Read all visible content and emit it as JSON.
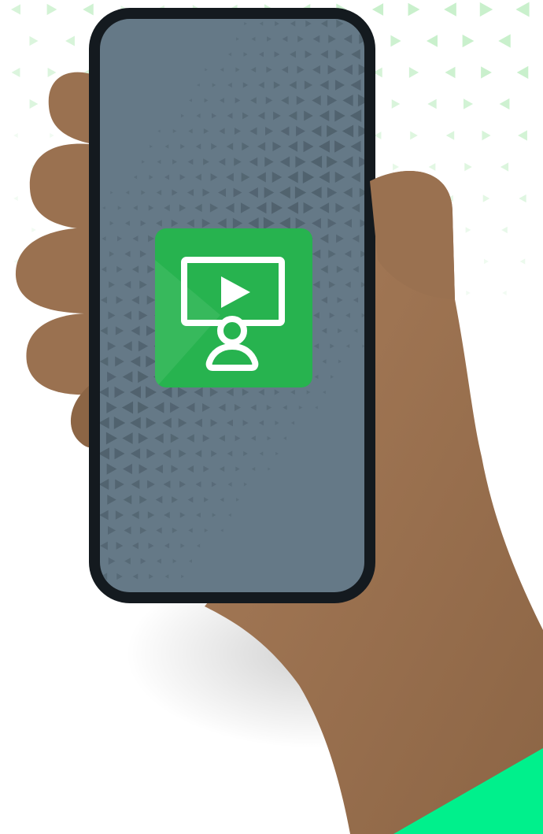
{
  "scene": {
    "background_color": "#ffffff",
    "pattern_color": "#c9f0cc",
    "hand_color": "#9a7150",
    "hand_shadow_color": "#7d5a3f",
    "sleeve_color": "#00f08c",
    "phone_frame_color": "#141a1f",
    "screen_color": "#657987",
    "screen_pattern_color": "#4e5f6b"
  },
  "app_icon": {
    "icon": "video-presenter-icon",
    "background_color": "#27b34f",
    "symbol_color": "#ffffff"
  }
}
